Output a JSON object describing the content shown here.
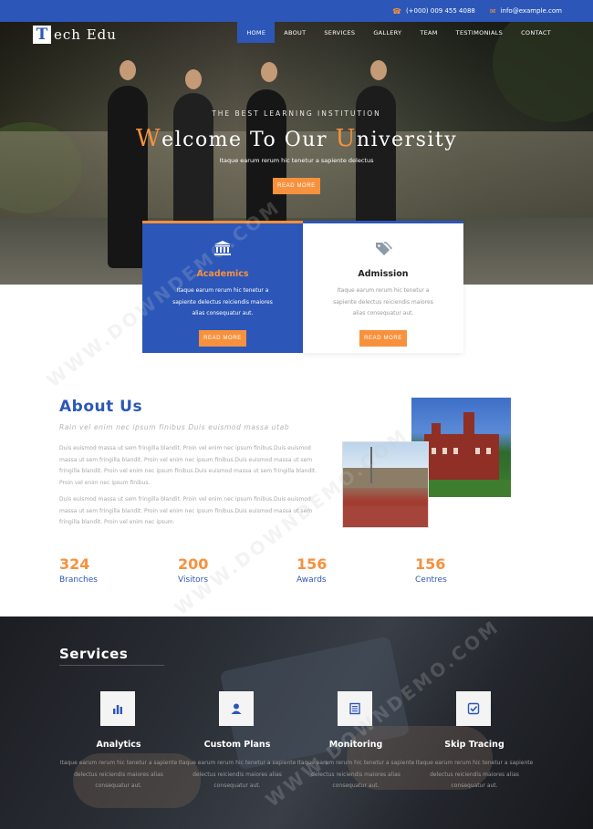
{
  "topbar": {
    "phone": "(+000) 009 455 4088",
    "email": "info@example.com",
    "phone_icon": "phone-icon",
    "email_icon": "envelope-icon"
  },
  "brand": {
    "letter": "T",
    "rest": "ech Edu"
  },
  "nav": [
    "HOME",
    "ABOUT",
    "SERVICES",
    "GALLERY",
    "TEAM",
    "TESTIMONIALS",
    "CONTACT"
  ],
  "hero": {
    "subtitle": "THE BEST LEARNING INSTITUTION",
    "title_w": "W",
    "title_mid": "elcome To Our ",
    "title_u": "U",
    "title_end": "niversity",
    "description": "Itaque earum rerum hic tenetur a sapiente delectus",
    "button": "READ MORE"
  },
  "features": [
    {
      "title": "Academics",
      "icon": "university-icon",
      "description": "Itaque earum rerum hic tenetur a sapiente delectus reiciendis maiores alias consequatur aut.",
      "button": "READ MORE"
    },
    {
      "title": "Admission",
      "icon": "tags-icon",
      "description": "Itaque earum rerum hic tenetur a sapiente delectus reiciendis maiores alias consequatur aut.",
      "button": "READ MORE"
    }
  ],
  "about": {
    "title": "About Us",
    "subtitle": "Rain vel enim nec ipsum finibus Duis euismod massa utab",
    "p1": "Duis euismod massa ut sem fringilla blandit. Proin vel enim nec ipsum finibus.Duis euismod massa ut sem fringilla blandit. Proin vel enim nec ipsum finibus.Duis euismod massa ut sem fringilla blandit. Proin vel enim nec ipsum finibus.Duis euismod massa ut sem fringilla blandit. Proin vel enim nec ipsum finibus.",
    "p2": "Duis euismod massa ut sem fringilla blandit. Proin vel enim nec ipsum finibus.Duis euismod massa ut sem fringilla blandit. Proin vel enim nec ipsum finibus.Duis euismod massa ut sem fringilla blandit. Proin vel enim nec ipsum."
  },
  "stats": [
    {
      "value": "324",
      "label": "Branches"
    },
    {
      "value": "200",
      "label": "Visitors"
    },
    {
      "value": "156",
      "label": "Awards"
    },
    {
      "value": "156",
      "label": "Centres"
    }
  ],
  "services": {
    "title": "Services",
    "items": [
      {
        "name": "Analytics",
        "icon": "bar-chart-icon",
        "description": "Itaque earum rerum hic tenetur a sapiente delectus reiciendis maiores alias consequatur aut."
      },
      {
        "name": "Custom Plans",
        "icon": "user-icon",
        "description": "Itaque earum rerum hic tenetur a sapiente delectus reiciendis maiores alias consequatur aut."
      },
      {
        "name": "Monitoring",
        "icon": "list-icon",
        "description": "Itaque earum rerum hic tenetur a sapiente delectus reiciendis maiores alias consequatur aut."
      },
      {
        "name": "Skip Tracing",
        "icon": "check-square-icon",
        "description": "Itaque earum rerum hic tenetur a sapiente delectus reiciendis maiores alias consequatur aut."
      }
    ]
  },
  "watermark": "WWW.DOWNDEMO.COM",
  "colors": {
    "primary": "#2c57b8",
    "accent": "#f7913d"
  }
}
